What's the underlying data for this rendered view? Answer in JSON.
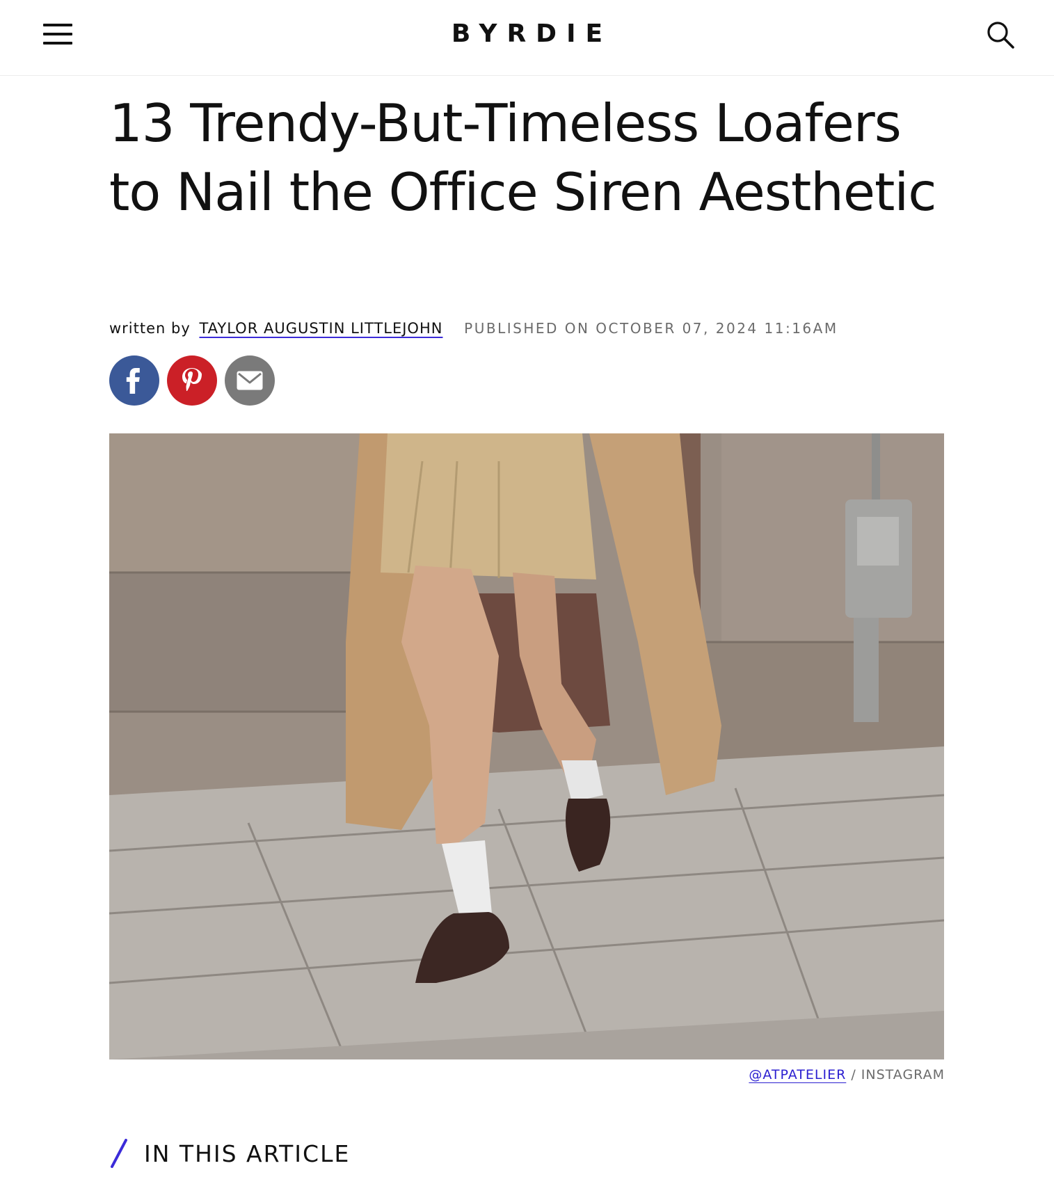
{
  "header": {
    "logo": "BYRDIE",
    "menu_icon": "hamburger-menu-icon",
    "search_icon": "search-icon"
  },
  "article": {
    "title": "13 Trendy-But-Timeless Loafers to Nail the Office Siren Aesthetic",
    "written_by_label": "written by",
    "author": "TAYLOR AUGUSTIN LITTLEJOHN",
    "published": "PUBLISHED ON OCTOBER 07, 2024 11:16AM"
  },
  "share": {
    "facebook_icon": "facebook-icon",
    "pinterest_icon": "pinterest-icon",
    "email_icon": "email-icon"
  },
  "image": {
    "credit_handle": "@ATPATELIER",
    "credit_separator": " / ",
    "credit_source": "INSTAGRAM"
  },
  "toc": {
    "heading": "IN THIS ARTICLE"
  },
  "colors": {
    "facebook": "#3b5998",
    "pinterest": "#cb2027",
    "email": "#7a7a7a",
    "accent": "#3b2bd9"
  }
}
